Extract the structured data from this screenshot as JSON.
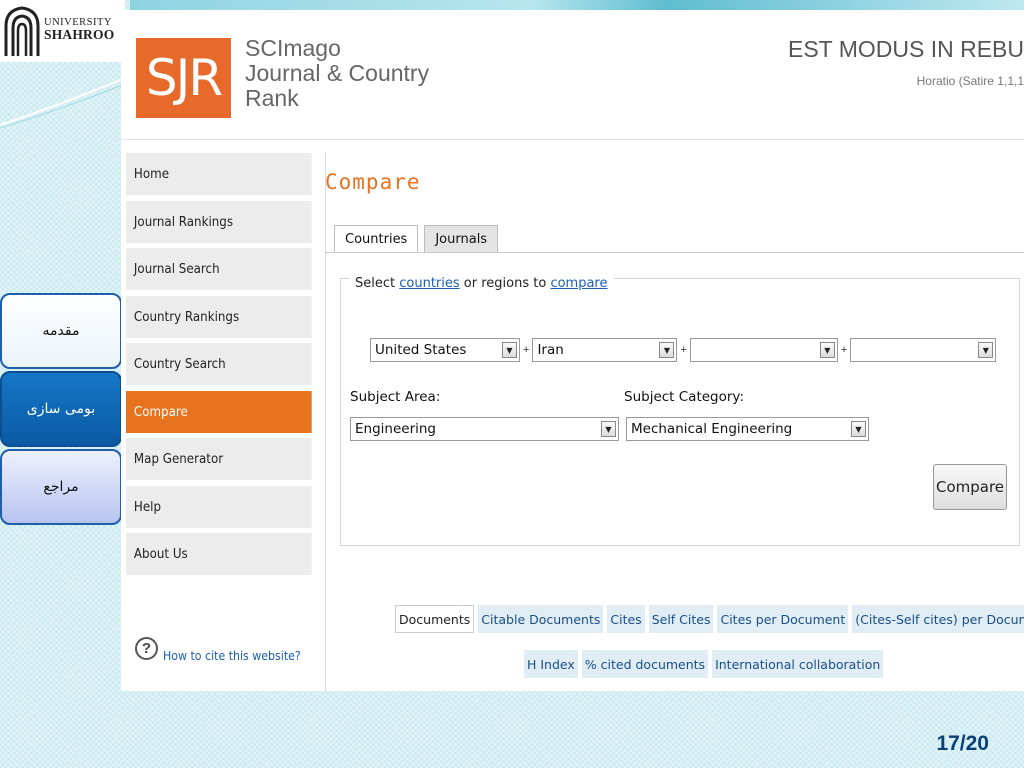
{
  "university": {
    "line1": "UNIVERSITY",
    "line2": "SHAHROO"
  },
  "side_nav": [
    {
      "label": "مقدمه"
    },
    {
      "label": "بومی سازی"
    },
    {
      "label": "مراجع"
    }
  ],
  "header": {
    "logo_text": "SJR",
    "title_lines": [
      "SCImago",
      "Journal & Country",
      "Rank"
    ],
    "motto": "EST MODUS IN REBU",
    "motto_source": "Horatio (Satire 1,1,1"
  },
  "menu": [
    {
      "label": "Home",
      "active": false
    },
    {
      "label": "Journal Rankings",
      "active": false
    },
    {
      "label": "Journal Search",
      "active": false
    },
    {
      "label": "Country Rankings",
      "active": false
    },
    {
      "label": "Country Search",
      "active": false
    },
    {
      "label": "Compare",
      "active": true
    },
    {
      "label": "Map Generator",
      "active": false
    },
    {
      "label": "Help",
      "active": false
    },
    {
      "label": "About Us",
      "active": false
    }
  ],
  "cite": {
    "icon": "?",
    "label": "How to cite this website?"
  },
  "content": {
    "title": "Compare",
    "tabs": [
      "Countries",
      "Journals"
    ],
    "legend": {
      "prefix": "Select",
      "link1": "countries",
      "middle": "or regions to",
      "link2": "compare"
    },
    "countries": [
      "United States",
      "Iran",
      "",
      ""
    ],
    "plus_sign": "+",
    "subject_area": {
      "label": "Subject Area:",
      "value": "Engineering"
    },
    "subject_category": {
      "label": "Subject Category:",
      "value": "Mechanical Engineering"
    },
    "compare_button": "Compare",
    "metrics_row1": [
      "Documents",
      "Citable Documents",
      "Cites",
      "Self Cites",
      "Cites per Document",
      "(Cites-Self cites) per Document"
    ],
    "metrics_row2": [
      "H Index",
      "% cited documents",
      "International collaboration"
    ],
    "active_metric": "Documents"
  },
  "slide_number": "17/20",
  "colors": {
    "accent": "#e8731f",
    "link": "#1a5fb4",
    "slide_number": "#0b3f7a"
  }
}
